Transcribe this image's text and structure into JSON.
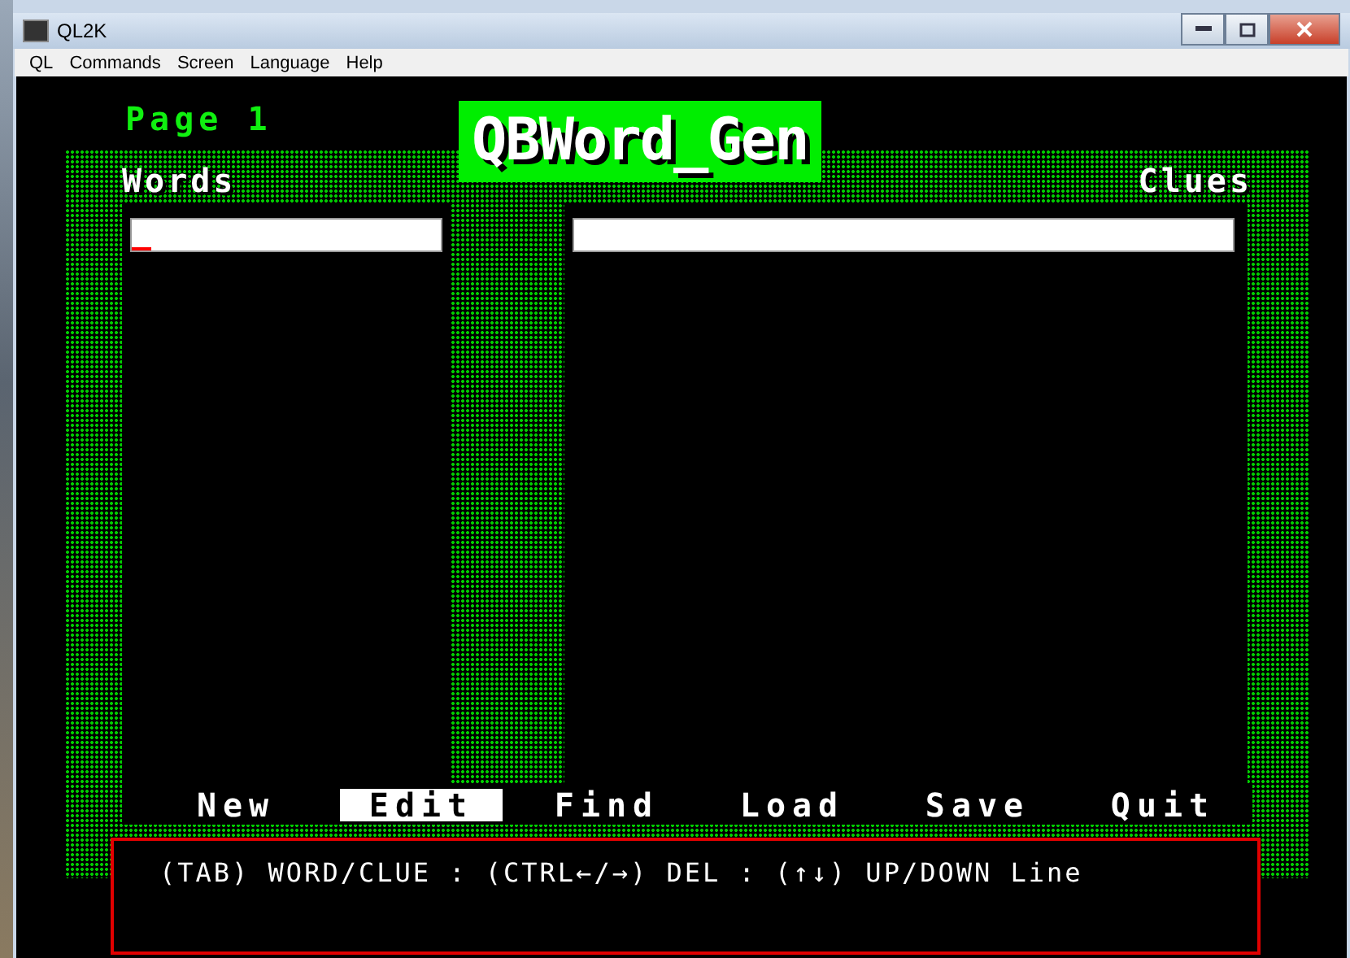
{
  "window": {
    "title": "QL2K"
  },
  "menu": [
    "QL",
    "Commands",
    "Screen",
    "Language",
    "Help"
  ],
  "page_label": "Page 1",
  "app_title": "QBWord_Gen",
  "words_label": "Words",
  "clues_label": "Clues",
  "commands": [
    {
      "label": "New",
      "selected": false
    },
    {
      "label": "Edit",
      "selected": true
    },
    {
      "label": "Find",
      "selected": false
    },
    {
      "label": "Load",
      "selected": false
    },
    {
      "label": "Save",
      "selected": false
    },
    {
      "label": "Quit",
      "selected": false
    }
  ],
  "help_text": "(TAB) WORD/CLUE : (CTRL←/→) DEL : (↑↓) UP/DOWN Line"
}
